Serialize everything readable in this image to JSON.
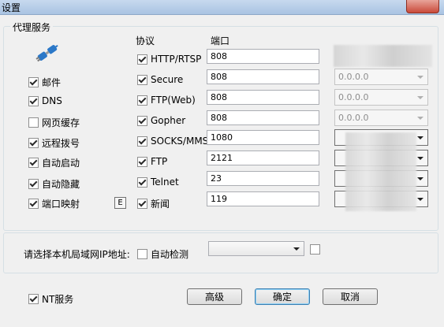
{
  "window": {
    "title": "设置"
  },
  "proxy_group": {
    "title": "代理服务"
  },
  "services": [
    {
      "label": "邮件",
      "checked": true
    },
    {
      "label": "DNS",
      "checked": true
    },
    {
      "label": "网页缓存",
      "checked": false
    },
    {
      "label": "远程拨号",
      "checked": true
    },
    {
      "label": "自动启动",
      "checked": true
    },
    {
      "label": "自动隐藏",
      "checked": true
    },
    {
      "label": "端口映射",
      "checked": true
    }
  ],
  "e_button": {
    "label": "E"
  },
  "columns": {
    "protocol": "协议",
    "port": "端口"
  },
  "protocols": [
    {
      "label": "HTTP/RTSP",
      "checked": true,
      "port": "808"
    },
    {
      "label": "Secure",
      "checked": true,
      "port": "808",
      "ip": "0.0.0.0"
    },
    {
      "label": "FTP(Web)",
      "checked": true,
      "port": "808",
      "ip": "0.0.0.0"
    },
    {
      "label": "Gopher",
      "checked": true,
      "port": "808",
      "ip": "0.0.0.0"
    },
    {
      "label": "SOCKS/MMS",
      "checked": true,
      "port": "1080"
    },
    {
      "label": "FTP",
      "checked": true,
      "port": "2121"
    },
    {
      "label": "Telnet",
      "checked": true,
      "port": "23"
    },
    {
      "label": "新闻",
      "checked": true,
      "port": "119"
    }
  ],
  "lan_ip": {
    "label": "请选择本机局域网IP地址:",
    "auto_detect_label": "自动检测",
    "auto_detect_checked": false,
    "extra_checked": false
  },
  "nt_service": {
    "label": "NT服务",
    "checked": true
  },
  "buttons": {
    "advanced": "高级",
    "ok": "确定",
    "cancel": "取消"
  }
}
